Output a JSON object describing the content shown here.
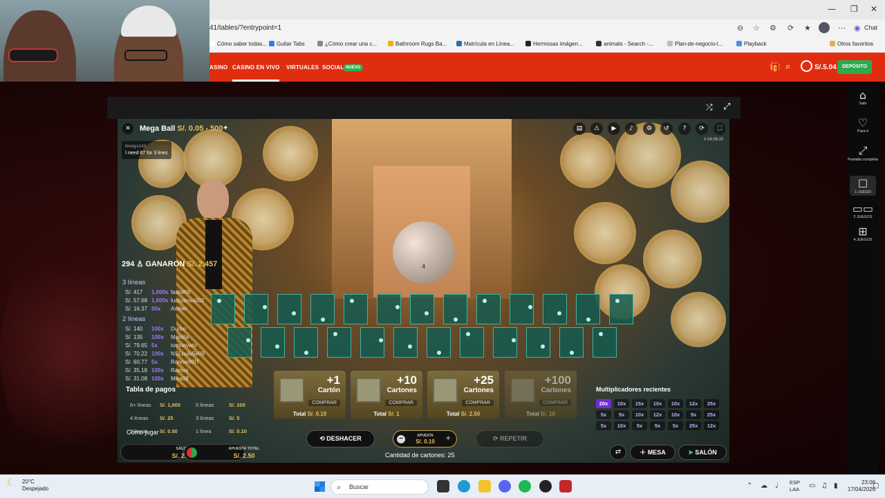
{
  "browser": {
    "url": "41/tables/?entrypoint=1",
    "chat_label": "Chat",
    "bookmarks": [
      {
        "label": "Cómo saber todas...",
        "color": "#ffffff"
      },
      {
        "label": "Guitar Tabs",
        "color": "#2d7ff9"
      },
      {
        "label": "¿Cómo crear una c...",
        "color": "#888888"
      },
      {
        "label": "Bathroom Rugs Ba...",
        "color": "#f2b01e"
      },
      {
        "label": "Matrícula en Línea...",
        "color": "#2b6cb0"
      },
      {
        "label": "Hermosas imágen...",
        "color": "#222222"
      },
      {
        "label": "animals - Search -...",
        "color": "#333333"
      },
      {
        "label": "Plan-de-negocio-l...",
        "color": "#bbbbbb"
      },
      {
        "label": "Playback",
        "color": "#4a8fe7"
      },
      {
        "label": "Otros favoritos",
        "color": "#e0b24a"
      }
    ]
  },
  "site_nav": {
    "items": [
      "ASINO",
      "CASINO EN VIVO",
      "VIRTUALES",
      "SOCIAL"
    ],
    "badge": "NUEVO",
    "balance": "S/.5.04",
    "deposit": "DEPÓSITO"
  },
  "sidebar": {
    "items": [
      {
        "label": "Salir",
        "icon": "home-icon"
      },
      {
        "label": "Para ti",
        "icon": "heart-icon"
      },
      {
        "label": "Pantalla completa",
        "icon": "fullscreen-icon"
      },
      {
        "label": "1 JUEGO",
        "icon": "single-view-icon"
      },
      {
        "label": "2 JUEGOS",
        "icon": "split-view-icon"
      },
      {
        "label": "4 JUEGOS",
        "icon": "grid-view-icon"
      }
    ]
  },
  "game": {
    "title": "Mega Ball",
    "limits": "S/. 0.05 - 500",
    "chat": {
      "user": "ilovejyu143:",
      "message": "I need 67 for 3 lines"
    },
    "round_id": "# 04:06:20",
    "ball_number": "4",
    "winners": {
      "count": "294",
      "label": "GANARON",
      "amount": "S/. 2,457"
    },
    "sections": [
      {
        "title": "3 líneas",
        "rows": [
          {
            "amt": "S/. 417",
            "mult": "1,000x",
            "name": "fashit69"
          },
          {
            "amt": "S/. 57.68",
            "mult": "1,000x",
            "name": "luckyboss002"
          },
          {
            "amt": "S/. 16.37",
            "mult": "50x",
            "name": "Amber"
          }
        ]
      },
      {
        "title": "2 líneas",
        "rows": [
          {
            "amt": "S/. 140",
            "mult": "100x",
            "name": "Durbo"
          },
          {
            "amt": "S/. 135",
            "mult": "100x",
            "name": "Maldita"
          },
          {
            "amt": "S/. 79.65",
            "mult": "5x",
            "name": "tomnevato"
          },
          {
            "amt": "S/. 70.22",
            "mult": "100x",
            "name": "NSLouisSe09"
          },
          {
            "amt": "S/. 60.77",
            "mult": "5x",
            "name": "Ronnie99IT"
          },
          {
            "amt": "S/. 35.18",
            "mult": "100x",
            "name": "Ramos"
          },
          {
            "amt": "S/. 31.08",
            "mult": "100x",
            "name": "Mica98"
          }
        ]
      }
    ],
    "paytable": {
      "title": "Tabla de pagos",
      "rows": [
        {
          "label": "6+ líneas",
          "value": "S/. 1,000"
        },
        {
          "label": "5 líneas",
          "value": "S/. 100"
        },
        {
          "label": "4 líneas",
          "value": "S/. 25"
        },
        {
          "label": "3 líneas",
          "value": "S/. 5"
        },
        {
          "label": "2 líneas",
          "value": "S/. 0.50"
        },
        {
          "label": "1 línea",
          "value": "S/. 0.10"
        }
      ],
      "how_to": "Cómo jugar"
    },
    "buy": [
      {
        "big": "+1",
        "sub": "Cartón",
        "comprar": "COMPRAR",
        "total_label": "Total",
        "total": "S/. 0.10",
        "disabled": false
      },
      {
        "big": "+10",
        "sub": "Cartones",
        "comprar": "COMPRAR",
        "total_label": "Total",
        "total": "S/. 1",
        "disabled": false
      },
      {
        "big": "+25",
        "sub": "Cartones",
        "comprar": "COMPRAR",
        "total_label": "Total",
        "total": "S/. 2.50",
        "disabled": false
      },
      {
        "big": "+100",
        "sub": "Cartones",
        "comprar": "COMPRAR",
        "total_label": "Total",
        "total": "S/. 10",
        "disabled": true
      }
    ],
    "multipliers": {
      "title": "Multiplicadores recientes",
      "rows": [
        [
          "20x",
          "10x",
          "15x",
          "10x",
          "10x",
          "12x",
          "25x"
        ],
        [
          "5x",
          "5x",
          "10x",
          "12x",
          "10x",
          "5x",
          "25x"
        ],
        [
          "5x",
          "10x",
          "5x",
          "5x",
          "5x",
          "25x",
          "12x"
        ]
      ]
    },
    "controls": {
      "undo": "DESHACER",
      "bet_label": "APUESTA",
      "bet_value": "S/. 0.10",
      "repeat": "REPETIR",
      "cards_count": "Cantidad de cartones: 25",
      "saldo_label": "SALDO",
      "saldo": "S/. 2.54",
      "total_bet_label": "APUESTA TOTAL",
      "total_bet": "S/. 2.50",
      "mesa": "MESA",
      "salon": "SALÓN"
    }
  },
  "taskbar": {
    "weather_temp": "20°C",
    "weather_desc": "Despejado",
    "search": "Buscar",
    "lang1": "ESP",
    "lang2": "LAA",
    "time": "23:06",
    "date": "17/04/2026"
  }
}
